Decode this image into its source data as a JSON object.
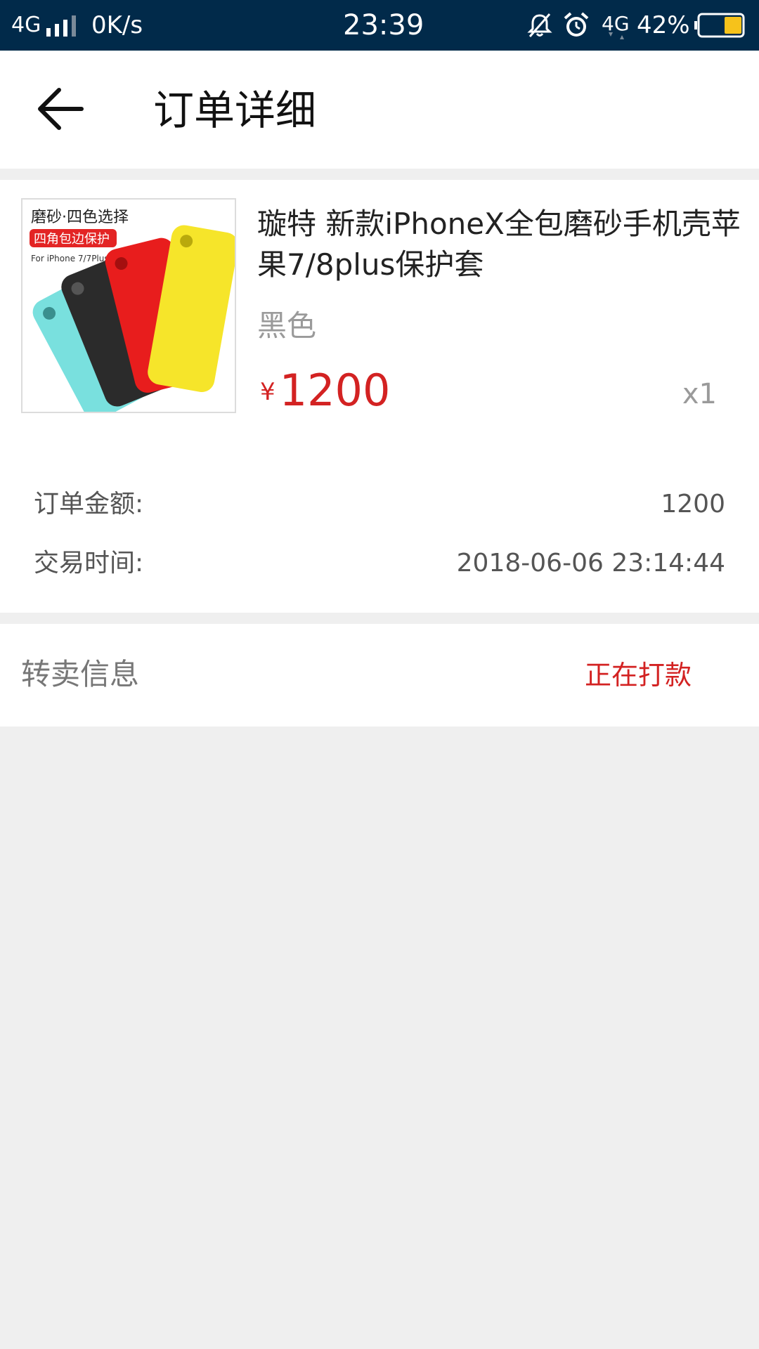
{
  "status_bar": {
    "network": "4G",
    "speed": "0K/s",
    "time": "23:39",
    "network2": "4G",
    "battery_percent": "42%",
    "battery_level": 0.42,
    "icons": [
      "signal-icon",
      "mute-bell-icon",
      "alarm-icon",
      "battery-icon"
    ]
  },
  "header": {
    "title": "订单详细",
    "back_icon": "back-arrow-icon"
  },
  "product": {
    "image_text_line1": "磨砂·四色选择",
    "image_badge": "四角包边保护",
    "image_text_line3": "For iPhone 7/7Plus",
    "title": "璇特 新款iPhoneX全包磨砂手机壳苹果7/8plus保护套",
    "variant": "黑色",
    "price_symbol": "¥",
    "price": "1200",
    "quantity": "x1"
  },
  "order_info": {
    "amount_label": "订单金额:",
    "amount_value": "1200",
    "time_label": "交易时间:",
    "time_value": "2018-06-06 23:14:44"
  },
  "resale": {
    "label": "转卖信息",
    "status": "正在打款"
  },
  "colors": {
    "status_bar": "#012a4a",
    "accent_red": "#d32222",
    "background": "#efefef",
    "battery_fill": "#f6c21b"
  }
}
